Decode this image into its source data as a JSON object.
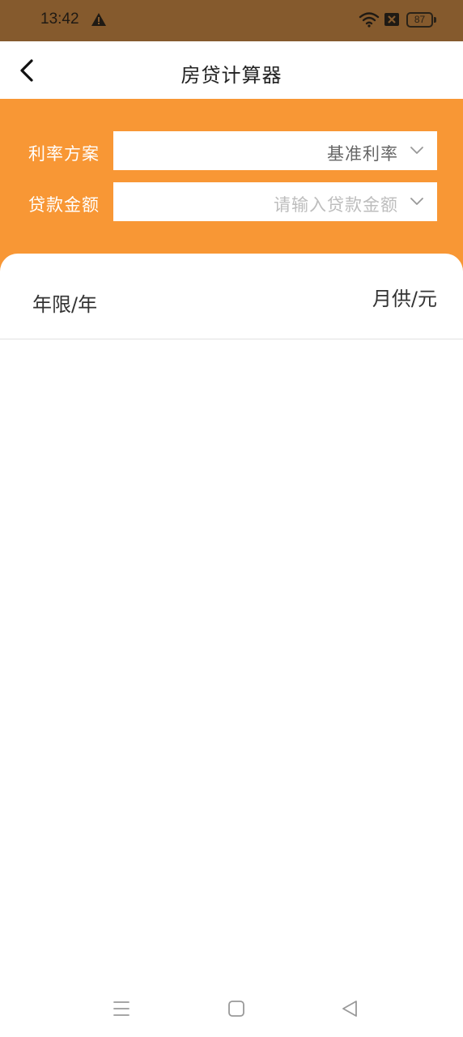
{
  "status_bar": {
    "time": "13:42",
    "battery": "87",
    "icons": [
      "warning-icon",
      "wifi-icon",
      "sim-icon",
      "battery-icon"
    ]
  },
  "header": {
    "title": "房贷计算器",
    "back_icon": "chevron-left-icon"
  },
  "form": {
    "rate_plan": {
      "label": "利率方案",
      "value": "基准利率"
    },
    "loan_amount": {
      "label": "贷款金额",
      "placeholder": "请输入贷款金额"
    }
  },
  "table": {
    "headers": [
      "年限/年",
      "月供/元"
    ]
  },
  "colors": {
    "status_bar": "#855a2d",
    "accent": "#f89735",
    "background": "#ffffff"
  },
  "nav_bar": {
    "icons": [
      "menu-icon",
      "home-icon",
      "back-icon"
    ]
  }
}
